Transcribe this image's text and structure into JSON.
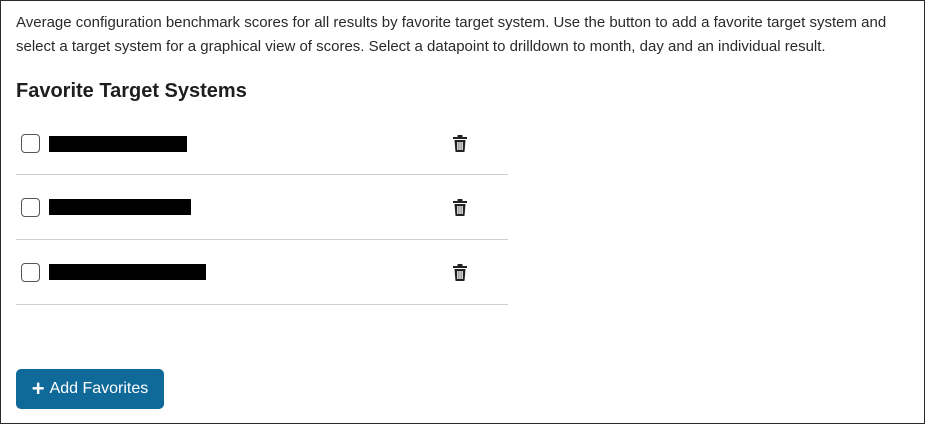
{
  "description": "Average configuration benchmark scores for all results by favorite target system. Use the button to add a favorite target system and select a target system for a graphical view of scores. Select a datapoint to drilldown to month, day and an individual result.",
  "section_title": "Favorite Target Systems",
  "favorites": [
    {
      "name": "",
      "checked": false,
      "delete_icon": "trash-icon",
      "redacted": true
    },
    {
      "name": "",
      "checked": false,
      "delete_icon": "trash-icon",
      "redacted": true
    },
    {
      "name": "",
      "checked": false,
      "delete_icon": "trash-icon",
      "redacted": true
    }
  ],
  "add_button": {
    "icon": "plus-icon",
    "plus_glyph": "+",
    "label": "Add Favorites",
    "color": "#0f6a9a"
  }
}
